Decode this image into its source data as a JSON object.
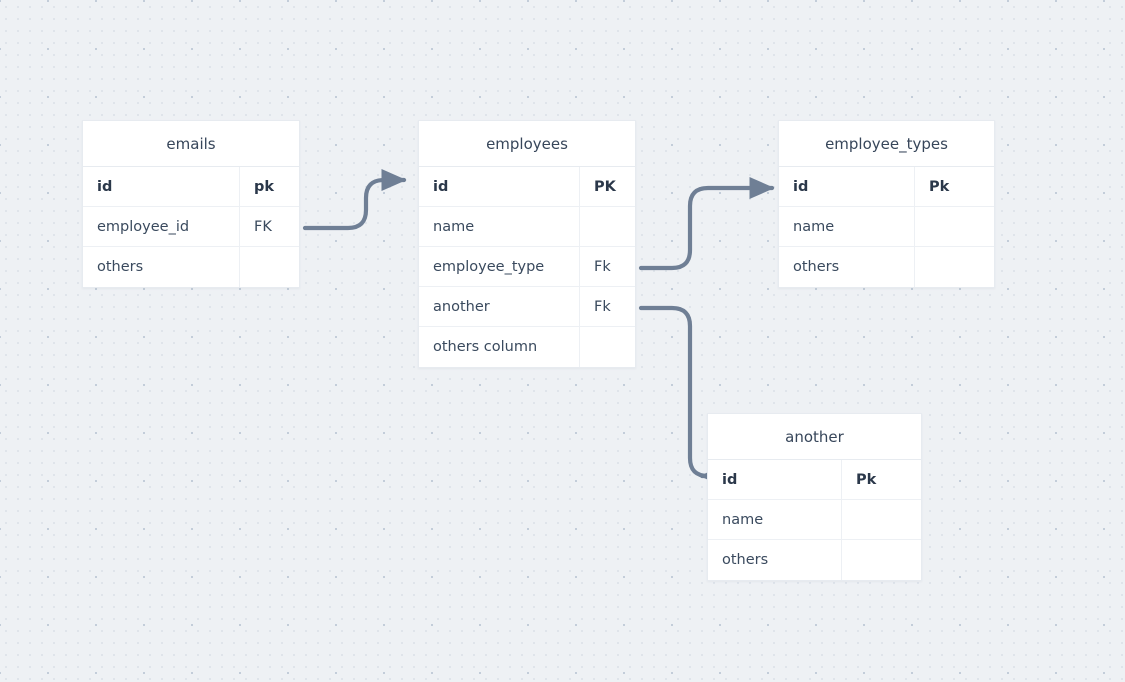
{
  "diagram": {
    "type": "entity-relationship-diagram",
    "canvas": {
      "background_color": "#eef1f4",
      "dot_color": "#dfe4ea",
      "accent_dot_color": "#c3cdd9"
    },
    "edge_color": "#6f7f95",
    "entities": [
      {
        "id": "emails",
        "title": "emails",
        "attributes": [
          {
            "name": "id",
            "key": "pk",
            "is_key": true
          },
          {
            "name": "employee_id",
            "key": "FK",
            "is_key": false
          },
          {
            "name": "others",
            "key": "",
            "is_key": false
          }
        ]
      },
      {
        "id": "employees",
        "title": "employees",
        "attributes": [
          {
            "name": "id",
            "key": "PK",
            "is_key": true
          },
          {
            "name": "name",
            "key": "",
            "is_key": false
          },
          {
            "name": "employee_type",
            "key": "Fk",
            "is_key": false
          },
          {
            "name": "another",
            "key": "Fk",
            "is_key": false
          },
          {
            "name": "others column",
            "key": "",
            "is_key": false
          }
        ]
      },
      {
        "id": "employee_types",
        "title": "employee_types",
        "attributes": [
          {
            "name": "id",
            "key": "Pk",
            "is_key": true
          },
          {
            "name": "name",
            "key": "",
            "is_key": false
          },
          {
            "name": "others",
            "key": "",
            "is_key": false
          }
        ]
      },
      {
        "id": "another",
        "title": "another",
        "attributes": [
          {
            "name": "id",
            "key": "Pk",
            "is_key": true
          },
          {
            "name": "name",
            "key": "",
            "is_key": false
          },
          {
            "name": "others",
            "key": "",
            "is_key": false
          }
        ]
      }
    ],
    "relationships": [
      {
        "id": "emails-to-employees",
        "from": "emails.employee_id",
        "to": "employees.id"
      },
      {
        "id": "employees-to-employee-types",
        "from": "employees.employee_type",
        "to": "employee_types.id"
      },
      {
        "id": "employees-to-another",
        "from": "employees.another",
        "to": "another.id"
      }
    ]
  }
}
